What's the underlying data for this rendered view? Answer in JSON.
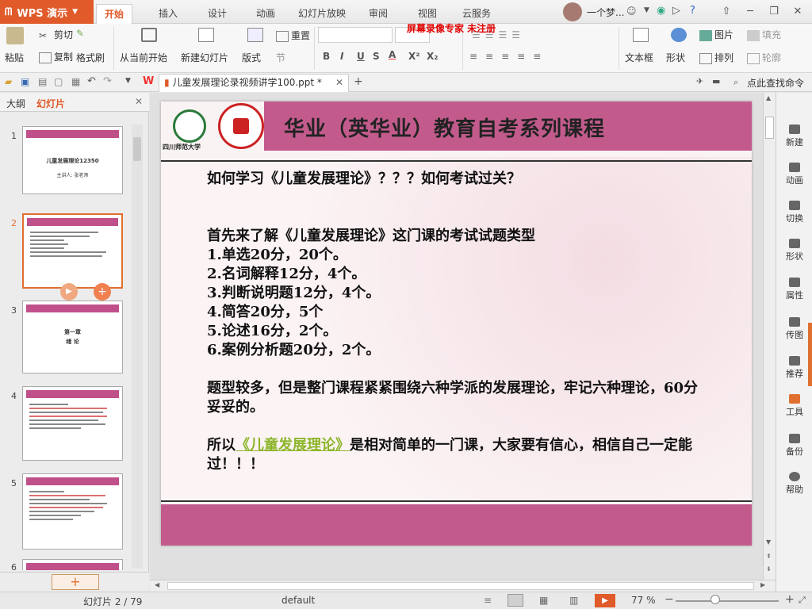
{
  "app": {
    "name": "WPS 演示"
  },
  "ribbon_tabs": [
    {
      "label": "开始"
    },
    {
      "label": "插入"
    },
    {
      "label": "设计"
    },
    {
      "label": "动画"
    },
    {
      "label": "幻灯片放映"
    },
    {
      "label": "审阅"
    },
    {
      "label": "视图"
    },
    {
      "label": "云服务"
    }
  ],
  "watermark": "屏幕录像专家 未注册",
  "user": {
    "name": "一个梦..."
  },
  "toolbar": {
    "paste": "粘贴",
    "cut": "剪切",
    "copy": "复制",
    "format_painter": "格式刷",
    "from_current": "从当前开始",
    "new_slide": "新建幻灯片",
    "layout": "版式",
    "section": "节",
    "reset": "重置",
    "textbox": "文本框",
    "shape": "形状",
    "picture": "图片",
    "fill": "填充",
    "arrange": "排列",
    "outline": "轮廓",
    "bold": "B",
    "italic": "I",
    "underline": "U",
    "shadow": "S",
    "fontcolor": "A",
    "superscript": "X²",
    "subscript": "X₂"
  },
  "quickbar": {
    "doc_title": "儿童发展理论录视频讲学100.ppt *",
    "search": "点此查找命令"
  },
  "leftpanel": {
    "tab_outline": "大纲",
    "tab_slides": "幻灯片",
    "thumbnails": [
      {
        "num": "1",
        "title": "儿童发展理论12350",
        "sub": "主讲人: 张老师"
      },
      {
        "num": "2",
        "title": "",
        "sub": ""
      },
      {
        "num": "3",
        "title": "第一章",
        "sub": "绪 论"
      },
      {
        "num": "4",
        "title": "",
        "sub": ""
      },
      {
        "num": "5",
        "title": "",
        "sub": ""
      },
      {
        "num": "6",
        "title": "",
        "sub": ""
      }
    ],
    "add_button": "+"
  },
  "slide": {
    "title": "华业（英华业）教育自考系列课程",
    "logo_left_text": "四川师范大学",
    "body": {
      "q1": "如何学习《儿童发展理论》？？？如何考试过关？",
      "intro": "首先来了解《儿童发展理论》这门课的考试试题类型",
      "items": [
        "1.单选20分，20个。",
        "2.名词解释12分，4个。",
        "3.判断说明题12分，4个。",
        "4.简答20分，5个",
        "5.论述16分，2个。",
        "6.案例分析题20分，2个。"
      ],
      "para1": "题型较多，但是整门课程紧紧围绕六种学派的发展理论，牢记六种理论，60分妥妥的。",
      "para2_pre": "所以",
      "para2_link": "《儿童发展理论》",
      "para2_post": "是相对简单的一门课，大家要有信心，相信自己一定能过！！！"
    }
  },
  "rightbar": [
    {
      "label": "新建"
    },
    {
      "label": "动画"
    },
    {
      "label": "切换"
    },
    {
      "label": "形状"
    },
    {
      "label": "属性"
    },
    {
      "label": "传图"
    },
    {
      "label": "推荐"
    },
    {
      "label": "工具"
    },
    {
      "label": "备份"
    },
    {
      "label": "帮助"
    }
  ],
  "status": {
    "slide_count": "幻灯片 2 / 79",
    "theme": "default",
    "zoom": "77 %"
  },
  "colors": {
    "accent": "#e05a2a",
    "slide_band": "#c25b8c"
  }
}
